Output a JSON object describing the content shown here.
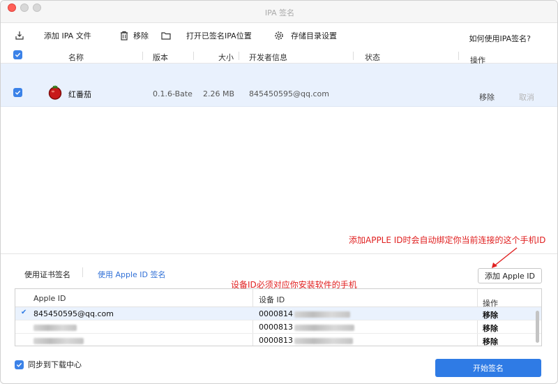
{
  "window": {
    "title": "IPA 签名"
  },
  "toolbar": {
    "add_ipa": "添加 IPA 文件",
    "remove": "移除",
    "open_signed": "打开已签名IPA位置",
    "storage_settings": "存储目录设置",
    "help": "如何使用IPA签名?"
  },
  "app_table": {
    "headers": {
      "name": "名称",
      "version": "版本",
      "size": "大小",
      "developer": "开发者信息",
      "status": "状态",
      "action": "操作"
    },
    "rows": [
      {
        "name": "红番茄",
        "version": "0.1.6-Bate",
        "size": "2.26 MB",
        "developer": "845450595@qq.com",
        "status": "",
        "remove": "移除",
        "cancel": "取消"
      }
    ]
  },
  "annotations": {
    "top": "添加APPLE ID时会自动绑定你当前连接的这个手机ID",
    "middle": "设备ID必须对应你安装软件的手机"
  },
  "tabs": {
    "cert_sign": "使用证书签名",
    "appleid_sign": "使用 Apple ID 签名"
  },
  "add_apple_id_button": "添加 Apple ID",
  "id_table": {
    "headers": {
      "apple_id": "Apple ID",
      "device_id": "设备 ID",
      "action": "操作"
    },
    "rows": [
      {
        "apple_id": "845450595@qq.com",
        "device_id_prefix": "0000814",
        "action": "移除"
      },
      {
        "apple_id": "",
        "device_id_prefix": "0000813",
        "action": "移除"
      },
      {
        "apple_id": "",
        "device_id_prefix": "0000813",
        "action": "移除"
      }
    ]
  },
  "footer": {
    "sync_label": "同步到下载中心",
    "start_button": "开始签名"
  },
  "colors": {
    "accent": "#2f7be5",
    "selection": "#e9f1fd",
    "annotation": "#e02020"
  }
}
